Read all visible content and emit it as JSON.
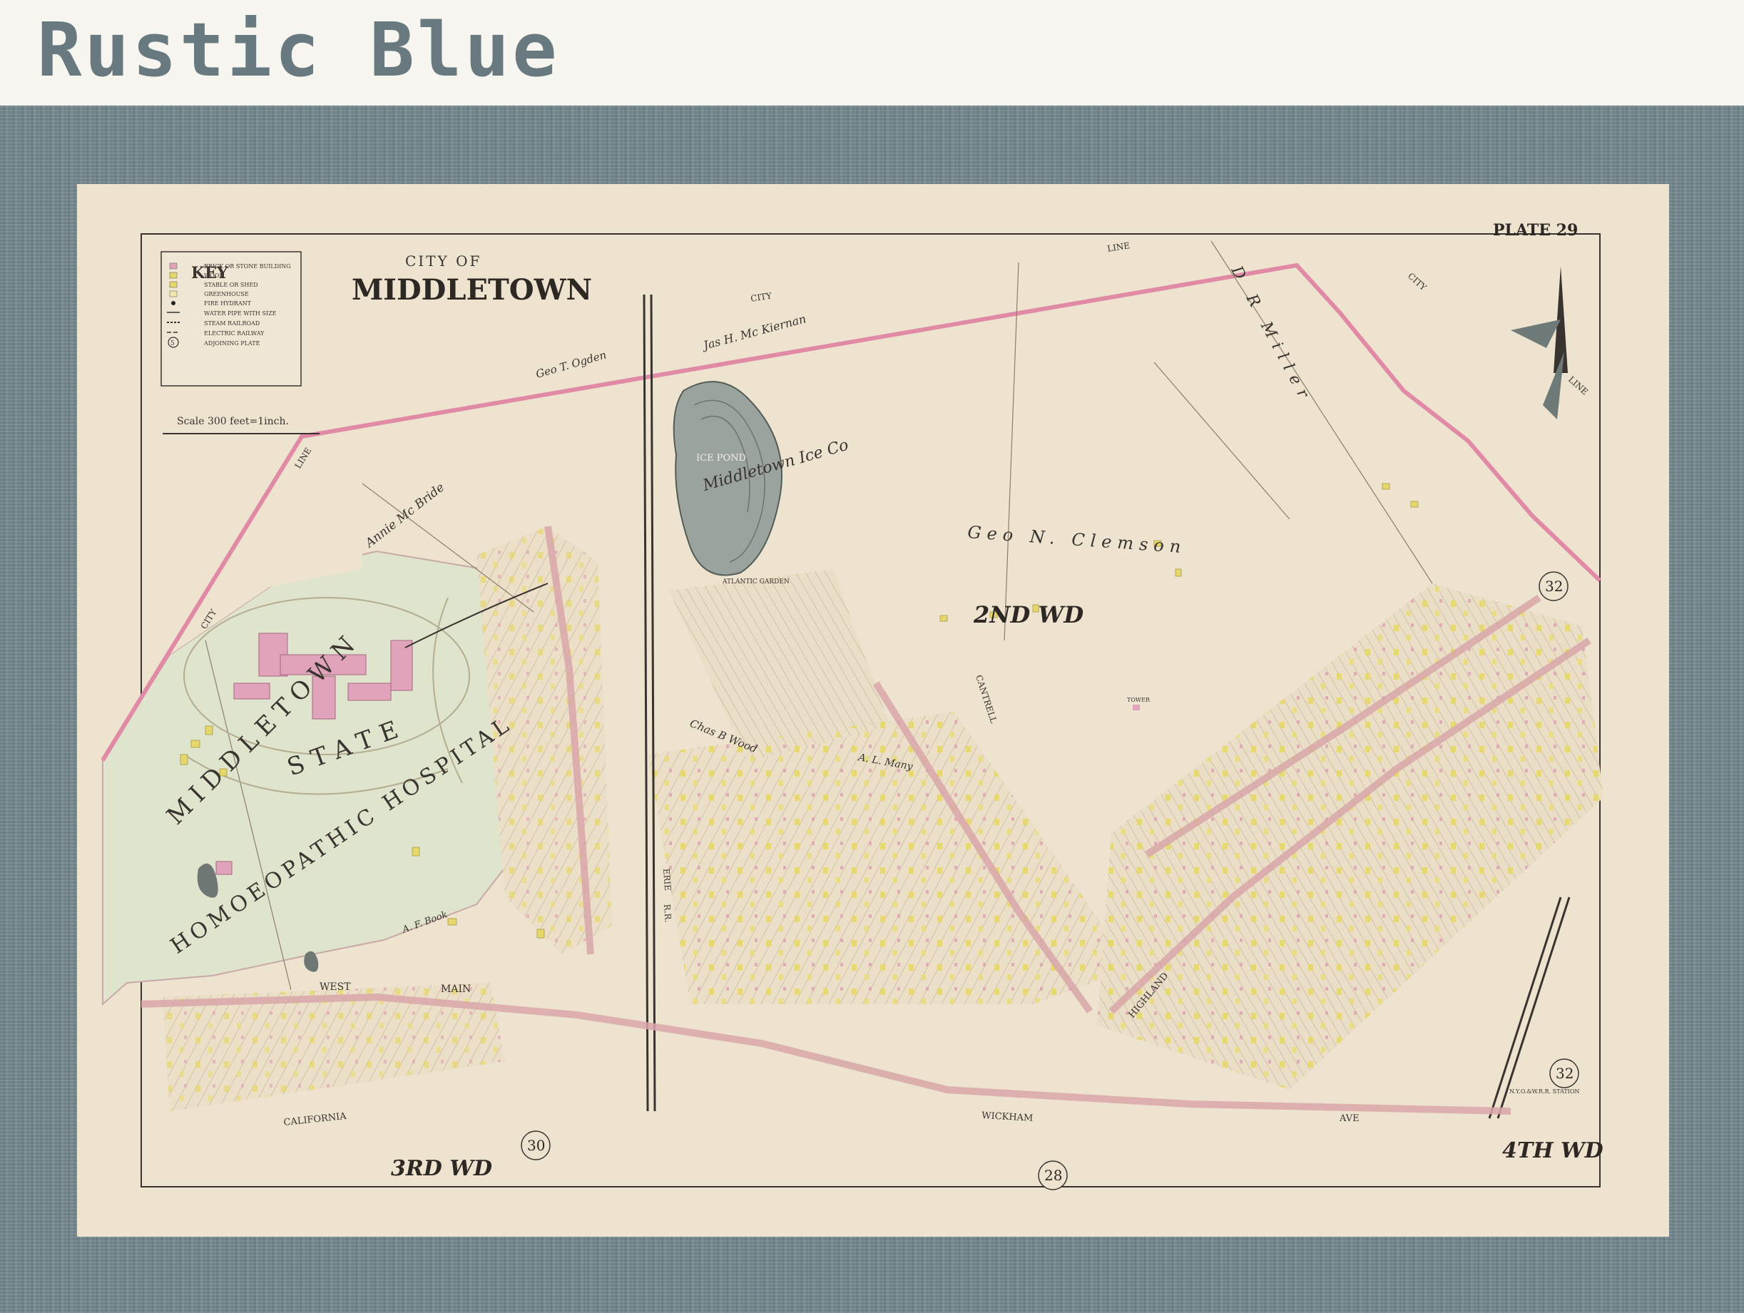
{
  "header": {
    "title": "Rustic Blue"
  },
  "map": {
    "plate": "PLATE 29",
    "city_of": "CITY OF",
    "city_name": "MIDDLETOWN",
    "key": {
      "title": "KEY",
      "items": [
        "BRICK OR STONE BUILDING",
        "WOOD",
        "STABLE OR SHED",
        "GREENHOUSE",
        "FIRE HYDRANT",
        "WATER PIPE WITH SIZE",
        "STEAM RAILROAD",
        "ELECTRIC RAILWAY",
        "ADJOINING PLATE"
      ],
      "adjoining_symbol": "5"
    },
    "scale": "Scale 300 feet=1inch.",
    "hospital": {
      "line1": "MIDDLETOWN",
      "line2": "STATE",
      "line3": "HOMOEOPATHIC HOSPITAL"
    },
    "wards": {
      "second": "2ND WD",
      "third": "3RD WD",
      "fourth": "4TH WD"
    },
    "plates": {
      "top_right": "32",
      "bottom_right": "32",
      "bottom_center": "28",
      "bottom_left": "30"
    },
    "ice_pond": "ICE POND",
    "ice_co": "Middletown Ice Co",
    "owners": {
      "clemson": "Geo  N.  Clemson",
      "miller": "D R Miller",
      "mcbride": "Annie Mc Bride",
      "mckiernan": "Jas H. Mc Kiernan",
      "ogden": "Geo T. Ogden",
      "wood": "Chas B Wood",
      "many": "A. L. Many",
      "book": "A. F. Book"
    },
    "labels": {
      "city_line": "CITY",
      "line": "LINE",
      "erie": "ERIE",
      "rr": "R.R.",
      "west": "WEST",
      "main": "MAIN",
      "ave": "AVE",
      "wickham": "WICKHAM",
      "california": "CALIFORNIA",
      "highland": "HIGHLAND",
      "cantrell": "CANTRELL",
      "tower": "TOWER",
      "atlantic": "ATLANTIC GARDEN",
      "station": "N.Y.O.&W.R.R. STATION"
    }
  }
}
